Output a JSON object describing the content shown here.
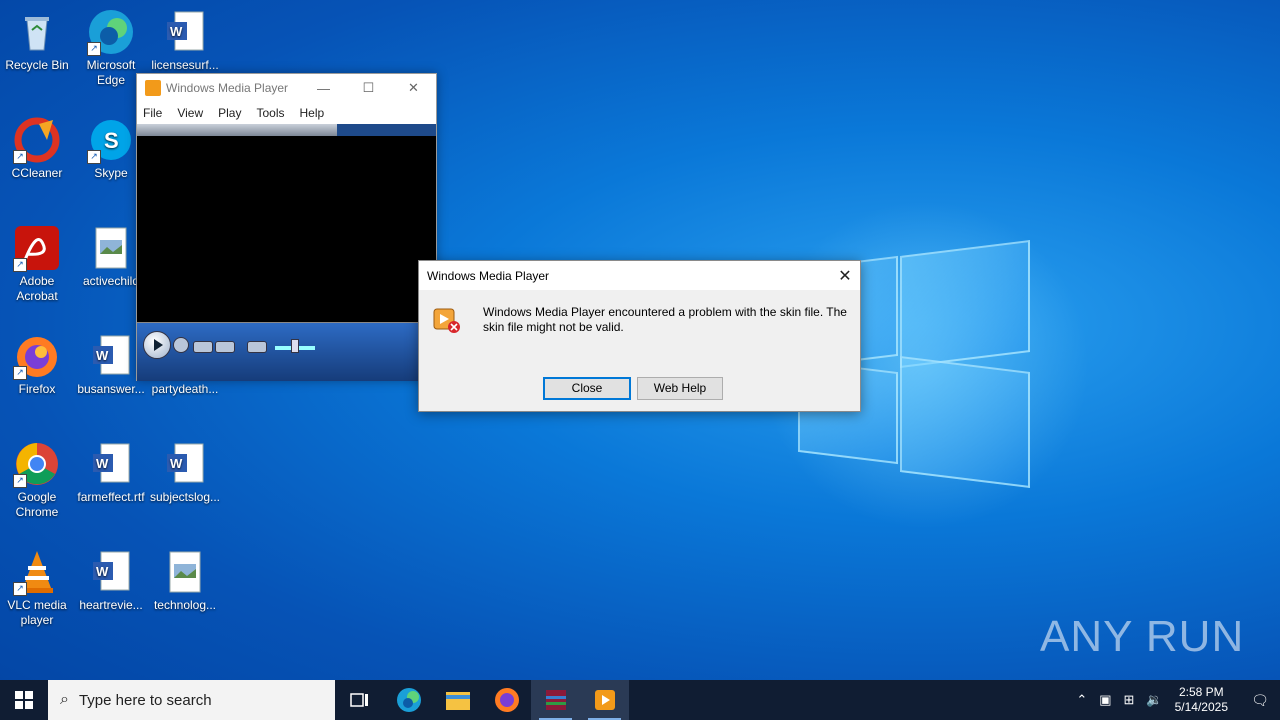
{
  "desktop": {
    "icons": [
      {
        "label": "Recycle Bin"
      },
      {
        "label": "Microsoft Edge"
      },
      {
        "label": "licensesurf..."
      },
      {
        "label": "CCleaner"
      },
      {
        "label": "Skype"
      },
      {
        "label": "Adobe Acrobat"
      },
      {
        "label": "activechild"
      },
      {
        "label": "Firefox"
      },
      {
        "label": "busanswer..."
      },
      {
        "label": "partydeath..."
      },
      {
        "label": "Google Chrome"
      },
      {
        "label": "farmeffect.rtf"
      },
      {
        "label": "subjectslog..."
      },
      {
        "label": "VLC media player"
      },
      {
        "label": "heartrevie..."
      },
      {
        "label": "technolog..."
      }
    ]
  },
  "wmp": {
    "title": "Windows Media Player",
    "menu": [
      "File",
      "View",
      "Play",
      "Tools",
      "Help"
    ]
  },
  "dialog": {
    "title": "Windows Media Player",
    "message": "Windows Media Player encountered a problem with the skin file. The skin file might not be valid.",
    "close_label": "Close",
    "webhelp_label": "Web Help"
  },
  "watermark": "ANY RUN",
  "taskbar": {
    "search_placeholder": "Type here to search",
    "time": "2:58 PM",
    "date": "5/14/2025"
  }
}
